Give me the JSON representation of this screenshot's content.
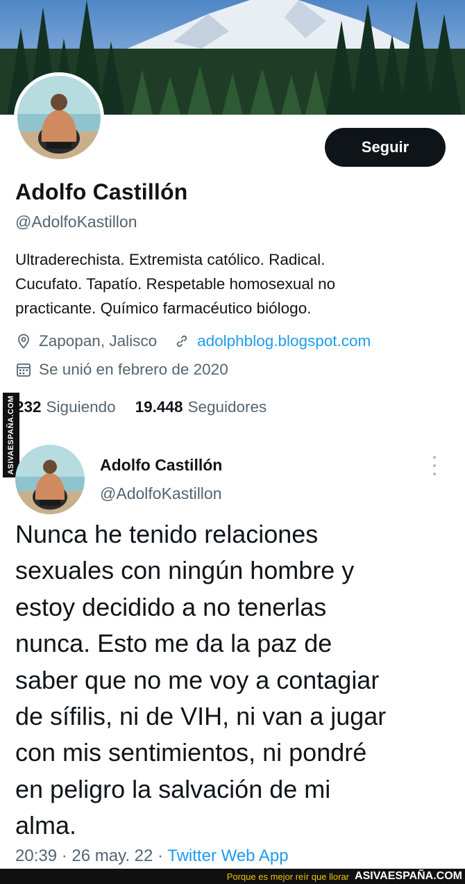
{
  "profile": {
    "name": "Adolfo Castillón",
    "handle": "@AdolfoKastillon",
    "follow_label": "Seguir",
    "bio_lines": [
      "Ultraderechista. Extremista católico. Radical.",
      "Cucufato. Tapatío. Respetable homosexual no",
      "practicante. Químico farmacéutico biólogo."
    ],
    "location": "Zapopan, Jalisco",
    "website": "adolphblog.blogspot.com",
    "joined": "Se unió en febrero de 2020",
    "following_count": "232",
    "following_label": "Siguiendo",
    "followers_count": "19.448",
    "followers_label": "Seguidores"
  },
  "tweet": {
    "name": "Adolfo Castillón",
    "handle": "@AdolfoKastillon",
    "lines": [
      "Nunca he tenido relaciones",
      "sexuales con ningún hombre y",
      "estoy decidido a no tenerlas",
      "nunca. Esto me da la paz de",
      "saber que no me voy a contagiar",
      "de sífilis, ni de VIH, ni van a jugar",
      "con mis sentimientos, ni pondré",
      "en peligro la salvación de mi",
      "alma."
    ],
    "time": "20:39",
    "date": "26 may. 22",
    "source": "Twitter Web App"
  },
  "watermark": {
    "side": "ASIVAESPAÑA.COM",
    "slogan": "Porque es mejor reír que llorar",
    "brand": "ASIVAESPAÑA.COM"
  },
  "icons": {
    "location": "location-pin-icon",
    "link": "link-icon",
    "calendar": "calendar-icon",
    "more": "more-options-icon"
  },
  "colors": {
    "text": "#0f1419",
    "secondary": "#536471",
    "link": "#1d9bf0",
    "button": "#0f1419"
  }
}
